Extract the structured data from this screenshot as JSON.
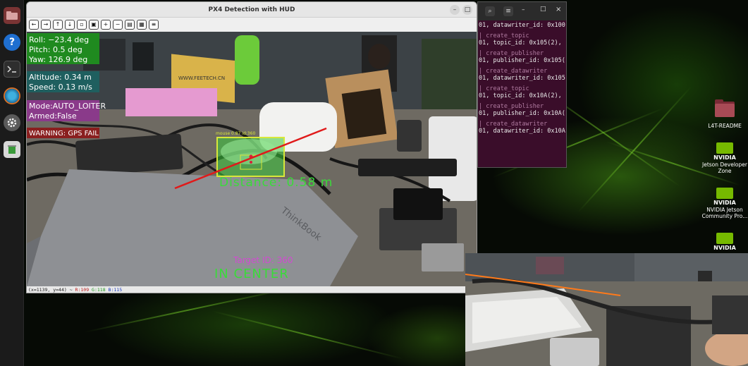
{
  "window": {
    "title": "PX4 Detection with HUD"
  },
  "hud": {
    "roll": "Roll: −23.4 deg",
    "pitch": "Pitch: 0.5 deg",
    "yaw": "Yaw: 126.9 deg",
    "altitude": "Altitude: 0.34 m",
    "speed": "Speed: 0.13 m/s",
    "mode": "Mode:AUTO_LOITER",
    "armed": "Armed:False",
    "warning": "WARNING: GPS FAIL",
    "distance": "Distance: 0.58 m",
    "target_id": "Target ID: 360",
    "in_center": "IN CENTER",
    "box_label": "mouse 0.87 id:360"
  },
  "status": {
    "coords": "(x=1139, y=44) ~",
    "r": "R:109",
    "g": "G:118",
    "b": "B:115"
  },
  "terminal": {
    "lines": [
      {
        "t": "01, datawriter_id: 0x100",
        "d": false
      },
      {
        "t": "",
        "d": false
      },
      {
        "t": "| create_topic",
        "d": true
      },
      {
        "t": "01, topic_id: 0x105(2),",
        "d": false
      },
      {
        "t": "",
        "d": false
      },
      {
        "t": "| create_publisher",
        "d": true
      },
      {
        "t": "01, publisher_id: 0x105(",
        "d": false
      },
      {
        "t": "",
        "d": false
      },
      {
        "t": "| create_datawriter",
        "d": true
      },
      {
        "t": "01, datawriter_id: 0x105",
        "d": false
      },
      {
        "t": "",
        "d": false
      },
      {
        "t": "| create_topic",
        "d": true
      },
      {
        "t": "01, topic_id: 0x10A(2),",
        "d": false
      },
      {
        "t": "",
        "d": false
      },
      {
        "t": "| create_publisher",
        "d": true
      },
      {
        "t": "01, publisher_id: 0x10A(",
        "d": false
      },
      {
        "t": "",
        "d": false
      },
      {
        "t": "| create_datawriter",
        "d": true
      },
      {
        "t": "01, datawriter_id: 0x10A",
        "d": false
      }
    ]
  },
  "desktop": {
    "icons": [
      {
        "label": "L4T-README",
        "icon": "folder-icon"
      },
      {
        "label": "Jetson Developer Zone",
        "icon": "nvidia-icon"
      },
      {
        "label": "NVIDIA Jetson Community Pro...",
        "icon": "nvidia-icon"
      },
      {
        "label": "",
        "icon": "nvidia-icon"
      }
    ],
    "nvidia_text": "NVIDIA"
  },
  "photo_text": {
    "laptop_brand": "ThinkBook",
    "sign": "WWW.FEETECH.CN"
  },
  "colors": {
    "hud_green": "#1f8a1f",
    "hud_teal": "#1f5f5f",
    "hud_purple": "#8a3a8a",
    "hud_red": "#8a1f1f",
    "box": "#d8e83a",
    "overlay_text_green": "#3adb3a",
    "target_magenta": "#d24ad2",
    "terminal_bg": "#3a0d2a"
  }
}
